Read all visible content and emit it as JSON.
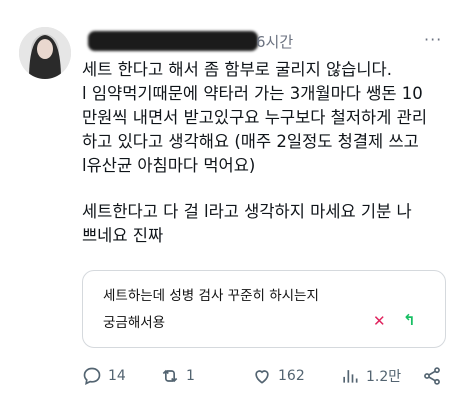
{
  "post": {
    "time": "6시간",
    "more_label": "···",
    "lines": [
      "세트 한다고 해서 좀 함부로 굴리지 않습니다.",
      "l 임약먹기때문에 약타러 가는 3개월마다 쌩돈 10",
      "만원씩 내면서 받고있구요 누구보다 철저하게 관리",
      "하고 있다고 생각해요 (매주 2일정도 청결제 쓰고",
      "l유산균 아침마다 먹어요)",
      "세트한다고 다 걸 l라고 생각하지 마세요 기분 나",
      "쁘네요 진짜"
    ]
  },
  "reply": {
    "line1": "세트하는데 성병 검사 꾸준히 하시는지",
    "line2": "궁금해서용",
    "x_icon": "✕",
    "send_icon": "↰"
  },
  "actions": {
    "replies": "14",
    "reposts": "1",
    "likes": "162",
    "views": "1.2만"
  },
  "icons": [
    "reply-icon",
    "repost-icon",
    "like-icon",
    "views-icon",
    "share-icon"
  ]
}
